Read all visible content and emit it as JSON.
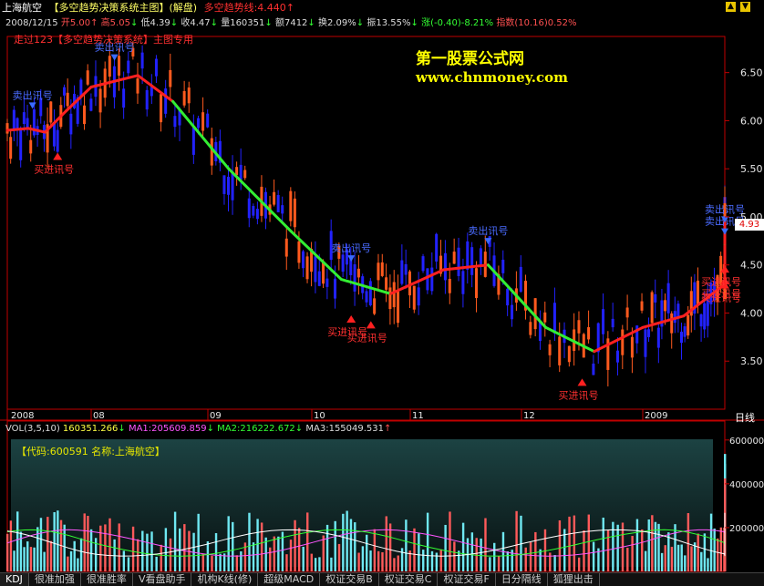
{
  "header": {
    "stock_name": "上海航空",
    "system_title": "【多空趋势决策系统主图】(解盘)",
    "trend_line_label": "多空趋势线:4.440",
    "trend_line_arrow": "↑",
    "formula_note": "走过123【多空趋势决策系统】主图专用",
    "quote": {
      "date": "2008/12/15",
      "open": "开5.00",
      "high": "高5.05",
      "low": "低4.39",
      "close": "收4.47",
      "volume": "量160351",
      "amount": "额7412",
      "turnover": "换2.09%",
      "amplitude": "振13.55%",
      "change": "涨(-0.40)-8.21%",
      "index": "指数(10.16)0.52%"
    }
  },
  "watermark": {
    "title": "第一股票公式网",
    "url": "www.chnmoney.com"
  },
  "controls": {
    "up": "▲",
    "down": "▼"
  },
  "price_panel": {
    "current_price": "4.93",
    "period_label": "日线",
    "signal_buy": "买进讯号",
    "signal_sell": "卖出讯号",
    "signals": [
      {
        "type": "sell",
        "month_index": 0.3
      },
      {
        "type": "buy",
        "month_index": 0.6
      },
      {
        "type": "sell",
        "month_index": 1.2
      },
      {
        "type": "buy",
        "month_index": 3.4
      },
      {
        "type": "buy",
        "month_index": 3.6
      },
      {
        "type": "sell",
        "month_index": 3.4
      },
      {
        "type": "sell",
        "month_index": 4.7
      },
      {
        "type": "buy",
        "month_index": 5.5
      },
      {
        "type": "sell",
        "month_index": 7.2
      },
      {
        "type": "buy",
        "month_index": 7.25
      },
      {
        "type": "sell",
        "month_index": 7.55
      },
      {
        "type": "buy",
        "month_index": 7.8
      },
      {
        "type": "buy",
        "month_index": 8.1
      }
    ]
  },
  "volume_panel": {
    "title": "VOL(3,5,10)",
    "vol": "160351.266",
    "ma1": "MA1:205609.859",
    "ma2": "MA2:216222.672",
    "ma3": "MA3:155049.531",
    "info_box": "【代码:600591 名称:上海航空】"
  },
  "colors": {
    "up": "#ff5a1e",
    "down": "#2222ff",
    "trend_up": "#ff2020",
    "trend_down": "#33ee33",
    "axis": "#c00000",
    "vol_up": "#ff5a5a",
    "vol_down": "#6fe8f2"
  },
  "tabs": [
    "KDJ",
    "很准加强",
    "很准胜率",
    "V看盘助手",
    "机构K线(修)",
    "超级MACD",
    "权证交易B",
    "权证交易C",
    "权证交易F",
    "日分隔线",
    "狐狸出击"
  ],
  "chart_data": [
    {
      "type": "candlestick",
      "title": "上海航空 日线",
      "x_tick_labels": [
        "2008",
        "08",
        "09",
        "10",
        "11",
        "12",
        "2009"
      ],
      "y_ticks": [
        3.5,
        4.0,
        4.5,
        5.0,
        5.5,
        6.0,
        6.5
      ],
      "ylim": [
        3.0,
        6.8
      ],
      "trend_line": {
        "name": "多空趋势线",
        "points": [
          [
            0,
            5.9
          ],
          [
            0.25,
            5.92
          ],
          [
            0.45,
            5.88
          ],
          [
            0.7,
            6.1
          ],
          [
            1.0,
            6.35
          ],
          [
            1.4,
            6.47
          ],
          [
            1.7,
            6.2
          ],
          [
            2.2,
            5.5
          ],
          [
            2.8,
            4.85
          ],
          [
            3.3,
            4.35
          ],
          [
            3.8,
            4.2
          ],
          [
            4.3,
            4.45
          ],
          [
            4.7,
            4.5
          ],
          [
            5.2,
            3.85
          ],
          [
            5.6,
            3.6
          ],
          [
            6.0,
            3.85
          ],
          [
            6.5,
            3.97
          ],
          [
            7.0,
            4.3
          ],
          [
            7.3,
            4.75
          ],
          [
            7.6,
            4.72
          ],
          [
            7.9,
            4.72
          ],
          [
            8.2,
            4.9
          ],
          [
            8.35,
            4.95
          ]
        ],
        "direction": [
          "up",
          "up",
          "up",
          "up",
          "up",
          "up",
          "down",
          "down",
          "down",
          "down",
          "up",
          "up",
          "down",
          "down",
          "up",
          "up",
          "up",
          "up",
          "down",
          "down",
          "up",
          "up",
          "up"
        ]
      },
      "last_close": 4.93
    },
    {
      "type": "bar",
      "title": "VOL(3,5,10)",
      "y_ticks": [
        200000,
        400000,
        600000
      ],
      "ylim": [
        0,
        620000
      ],
      "series_names": [
        "VOL",
        "MA1",
        "MA2",
        "MA3"
      ],
      "last_values": {
        "vol": 160351.266,
        "ma1": 205609.859,
        "ma2": 216222.672,
        "ma3": 155049.531
      }
    }
  ]
}
